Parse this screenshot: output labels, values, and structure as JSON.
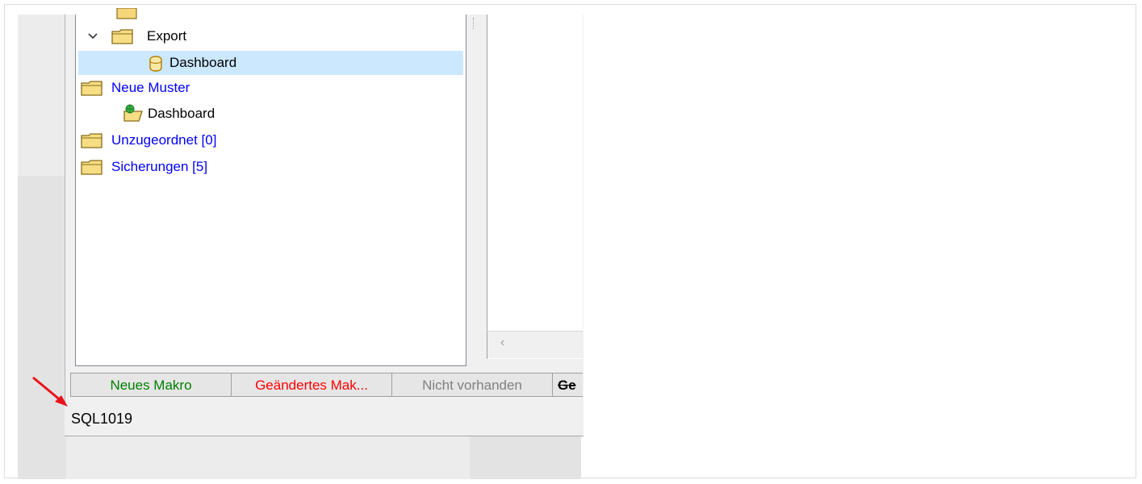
{
  "tree": {
    "items": [
      {
        "label": "Export",
        "type": "folder",
        "expanded": true,
        "color": "#000000"
      },
      {
        "label": "Dashboard",
        "type": "database",
        "selected": true,
        "color": "#000000"
      },
      {
        "label": "Neue Muster",
        "type": "folder",
        "color": "#0000ff"
      },
      {
        "label": "Dashboard",
        "type": "macro",
        "color": "#000000"
      },
      {
        "label": "Unzugeordnet [0]",
        "type": "folder",
        "color": "#0000ff"
      },
      {
        "label": "Sicherungen [5]",
        "type": "folder",
        "color": "#0000ff"
      }
    ]
  },
  "legend": {
    "items": [
      {
        "label": "Neues Makro",
        "color": "#008000"
      },
      {
        "label": "Geändertes Mak...",
        "color": "#ff0000"
      },
      {
        "label": "Nicht vorhanden",
        "color": "#808080"
      },
      {
        "label": "Ge",
        "color": "#000000"
      }
    ]
  },
  "statusbar": {
    "code": "SQL1019"
  },
  "icons": {
    "chevron": "chevron-down-icon",
    "folder": "folder-icon",
    "database": "database-icon",
    "macro": "macro-folder-icon",
    "scroll_left": "scroll-left-arrow-icon",
    "annotation": "red-arrow-icon"
  },
  "colors": {
    "selection": "#cce8ff",
    "accent_blue": "#0000ff",
    "annotation_red": "#e8141b"
  }
}
